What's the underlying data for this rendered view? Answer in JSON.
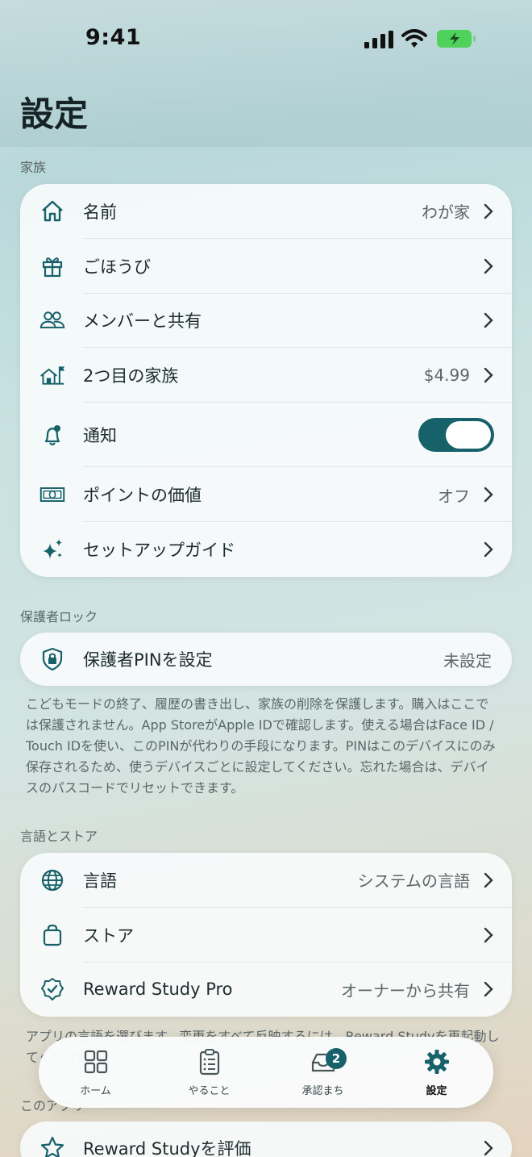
{
  "status_bar": {
    "time": "9:41"
  },
  "header": {
    "title": "設定"
  },
  "family_section": {
    "label": "家族",
    "rows": [
      {
        "icon": "house-icon",
        "label": "名前",
        "value": "わが家"
      },
      {
        "icon": "gift-icon",
        "label": "ごほうび",
        "value": ""
      },
      {
        "icon": "people-icon",
        "label": "メンバーと共有",
        "value": ""
      },
      {
        "icon": "house-flag-icon",
        "label": "2つ目の家族",
        "value": "$4.99"
      },
      {
        "icon": "bell-icon",
        "label": "通知",
        "toggle": true
      },
      {
        "icon": "banknote-icon",
        "label": "ポイントの価値",
        "value": "オフ"
      },
      {
        "icon": "sparkles-icon",
        "label": "セットアップガイド",
        "value": ""
      }
    ]
  },
  "lock_section": {
    "label": "保護者ロック",
    "row": {
      "icon": "lock-shield-icon",
      "label": "保護者PINを設定",
      "value": "未設定"
    },
    "footnote": "こどもモードの終了、履歴の書き出し、家族の削除を保護します。購入はここでは保護されません。App StoreがApple IDで確認します。使える場合はFace ID / Touch IDを使い、このPINが代わりの手段になります。PINはこのデバイスにのみ保存されるため、使うデバイスごとに設定してください。忘れた場合は、デバイスのパスコードでリセットできます。"
  },
  "language_section": {
    "label": "言語とストア",
    "rows": [
      {
        "icon": "globe-icon",
        "label": "言語",
        "value": "システムの言語"
      },
      {
        "icon": "bag-icon",
        "label": "ストア",
        "value": ""
      },
      {
        "icon": "checkmark-seal-icon",
        "label": "Reward Study Pro",
        "value": "オーナーから共有"
      }
    ],
    "footnote": "アプリの言語を選びます。変更をすべて反映するには、Reward Studyを再起動してください。"
  },
  "about_section": {
    "label": "このアプリ",
    "row": {
      "icon": "star-icon",
      "label": "Reward Studyを評価"
    }
  },
  "tabbar": {
    "tabs": [
      {
        "label": "ホーム"
      },
      {
        "label": "やること"
      },
      {
        "label": "承認まち",
        "badge": "2"
      },
      {
        "label": "設定"
      }
    ]
  },
  "colors": {
    "accent": "#17616a"
  }
}
